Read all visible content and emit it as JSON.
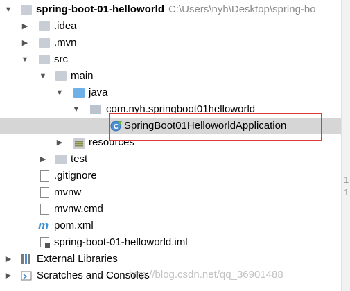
{
  "tree": {
    "project": {
      "name": "spring-boot-01-helloworld",
      "path": "C:\\Users\\nyh\\Desktop\\spring-bo"
    },
    "items": [
      {
        "label": ".idea",
        "icon": "folder-icon"
      },
      {
        "label": ".mvn",
        "icon": "folder-icon"
      },
      {
        "label": "src",
        "icon": "folder-icon"
      },
      {
        "label": "main",
        "icon": "folder-icon"
      },
      {
        "label": "java",
        "icon": "source-folder-icon"
      },
      {
        "label": "com.nyh.springboot01helloworld",
        "icon": "package-icon"
      },
      {
        "label": "SpringBoot01HelloworldApplication",
        "icon": "spring-class-icon"
      },
      {
        "label": "resources",
        "icon": "resources-folder-icon"
      },
      {
        "label": "test",
        "icon": "folder-icon"
      },
      {
        "label": ".gitignore",
        "icon": "file-icon"
      },
      {
        "label": "mvnw",
        "icon": "file-icon"
      },
      {
        "label": "mvnw.cmd",
        "icon": "file-icon"
      },
      {
        "label": "pom.xml",
        "icon": "maven-icon"
      },
      {
        "label": "spring-boot-01-helloworld.iml",
        "icon": "module-file-icon"
      },
      {
        "label": "External Libraries",
        "icon": "libraries-icon"
      },
      {
        "label": "Scratches and Consoles",
        "icon": "scratches-icon"
      }
    ]
  },
  "gutter": {
    "line_numbers": [
      "1",
      "1"
    ]
  },
  "watermark": "http://blog.csdn.net/qq_36901488",
  "colors": {
    "selection": "#d6d6d6",
    "highlight_border": "#e03b3b",
    "path_text": "#8a8a8a"
  }
}
